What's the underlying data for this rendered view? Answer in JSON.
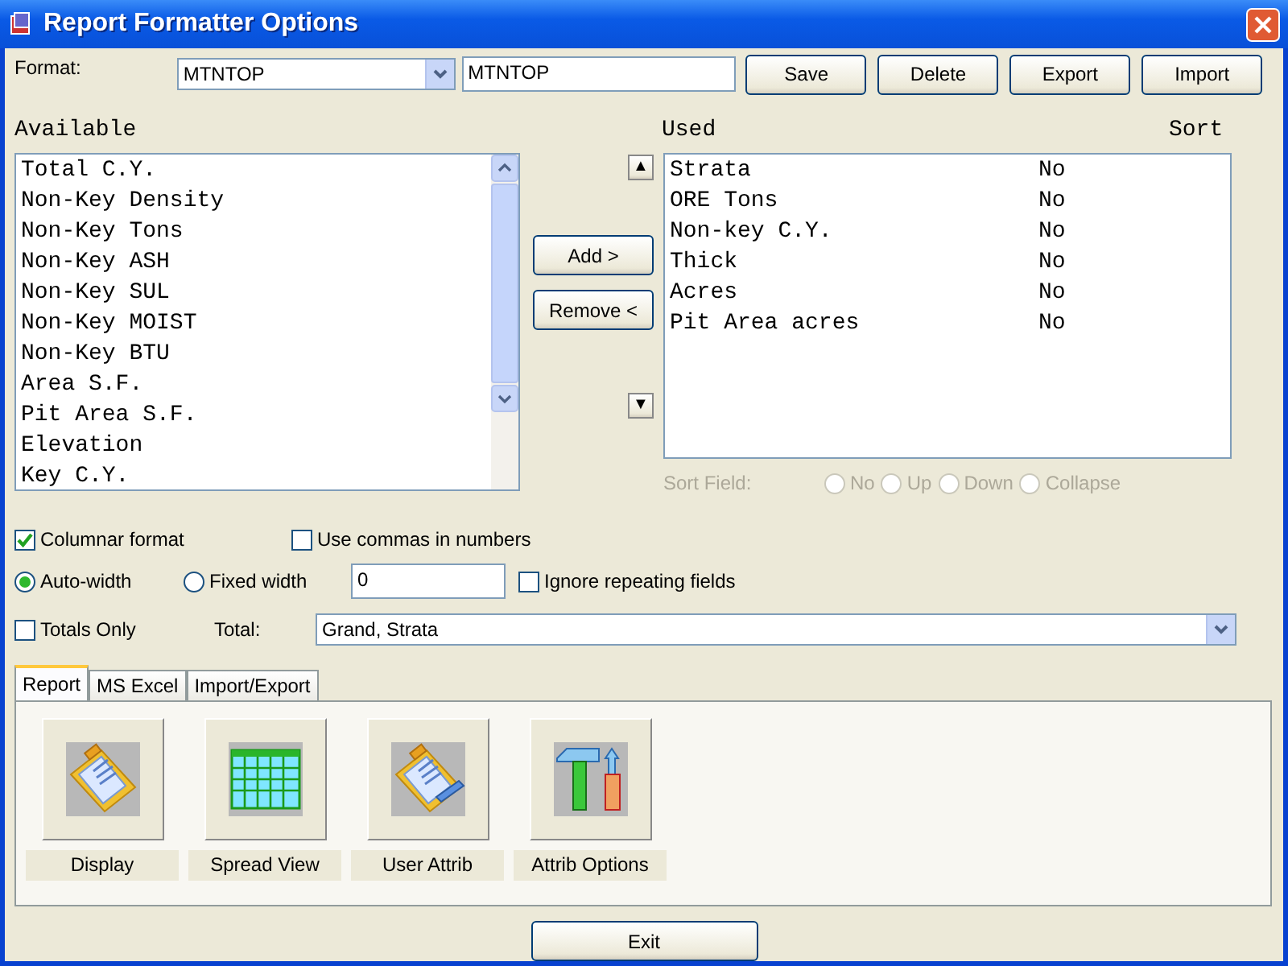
{
  "window": {
    "title": "Report Formatter Options"
  },
  "format": {
    "label": "Format:",
    "combo_value": "MTNTOP",
    "name_value": "MTNTOP"
  },
  "top_buttons": [
    "Save",
    "Delete",
    "Export",
    "Import"
  ],
  "available": {
    "heading": "Available",
    "items": [
      "Total C.Y.",
      "Non-Key Density",
      "Non-Key Tons",
      "Non-Key ASH",
      "Non-Key SUL",
      "Non-Key MOIST",
      "Non-Key BTU",
      "Area S.F.",
      "Pit Area S.F.",
      "Elevation",
      "Key C.Y."
    ]
  },
  "move_buttons": {
    "up": "▲",
    "add": "Add >",
    "remove": "Remove <",
    "down": "▼"
  },
  "used": {
    "heading": "Used",
    "sort_heading": "Sort",
    "rows": [
      {
        "field": "Strata",
        "sort": "No"
      },
      {
        "field": "ORE Tons",
        "sort": "No"
      },
      {
        "field": "Non-key C.Y.",
        "sort": "No"
      },
      {
        "field": "Thick",
        "sort": "No"
      },
      {
        "field": "Acres",
        "sort": "No"
      },
      {
        "field": "Pit Area acres",
        "sort": "No"
      }
    ]
  },
  "sort_field": {
    "label": "Sort Field:",
    "disabled": true,
    "options": [
      {
        "label": "No",
        "selected": false
      },
      {
        "label": "Up",
        "selected": false
      },
      {
        "label": "Down",
        "selected": false
      },
      {
        "label": "Collapse",
        "selected": false
      }
    ]
  },
  "columnar_format": {
    "label": "Columnar format",
    "checked": true
  },
  "use_commas": {
    "label": "Use commas in numbers",
    "checked": false
  },
  "width_modes": [
    {
      "label": "Auto-width",
      "selected": true
    },
    {
      "label": "Fixed width",
      "selected": false
    }
  ],
  "fixed_width_value": "0",
  "ignore_repeating": {
    "label": "Ignore repeating fields",
    "checked": false
  },
  "totals_only": {
    "label": "Totals Only",
    "checked": false
  },
  "total": {
    "label": "Total:",
    "value": "Grand, Strata"
  },
  "tabs": [
    {
      "label": "Report",
      "selected": true
    },
    {
      "label": "MS Excel",
      "selected": false
    },
    {
      "label": "Import/Export",
      "selected": false
    }
  ],
  "tools": [
    {
      "kind": "clipboard",
      "label": "Display"
    },
    {
      "kind": "grid",
      "label": "Spread View"
    },
    {
      "kind": "pen",
      "label": "User Attrib"
    },
    {
      "kind": "tools",
      "label": "Attrib Options"
    }
  ],
  "exit_button": "Exit"
}
